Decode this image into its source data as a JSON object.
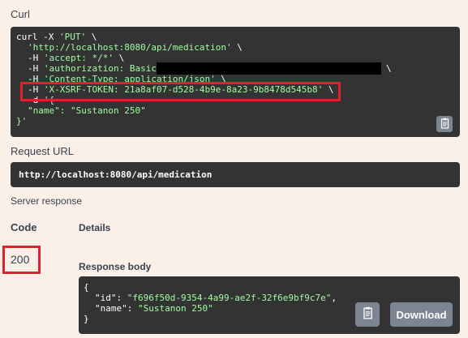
{
  "curl": {
    "label": "Curl",
    "lines": [
      "curl -X ",
      "'PUT'",
      " \\",
      "'http://localhost:8080/api/medication'",
      " \\",
      "-H ",
      "'accept: */*'",
      " \\",
      "-H ",
      "'authorization: Basic ",
      "\\",
      "-H ",
      "'Content-Type: application/json'",
      " \\",
      "-H ",
      "'X-XSRF-TOKEN: 21a8af07-d528-4b9e-8a23-9b8478d545b8'",
      " \\",
      "-d ",
      "'{",
      "\"name\": \"Sustanon 250\"",
      "}'"
    ]
  },
  "request_url": {
    "label": "Request URL",
    "value": "http://localhost:8080/api/medication"
  },
  "server_response": {
    "label": "Server response",
    "code_header": "Code",
    "details_header": "Details",
    "status_code": "200",
    "response_body_label": "Response body",
    "body_lines": [
      "{",
      "\"id\": ",
      "\"f696f50d-9354-4a99-ae2f-32f6e9bf9c7e\"",
      ",",
      "\"name\": ",
      "\"Sustanon 250\"",
      "}"
    ],
    "download_label": "Download"
  },
  "icons": {
    "copy": "clipboard-icon"
  },
  "colors": {
    "background": "#faf0e8",
    "code_bg": "#333333",
    "string_green": "#a2fca2",
    "highlight_red": "#e0202a",
    "button_gray": "#7d8492"
  }
}
